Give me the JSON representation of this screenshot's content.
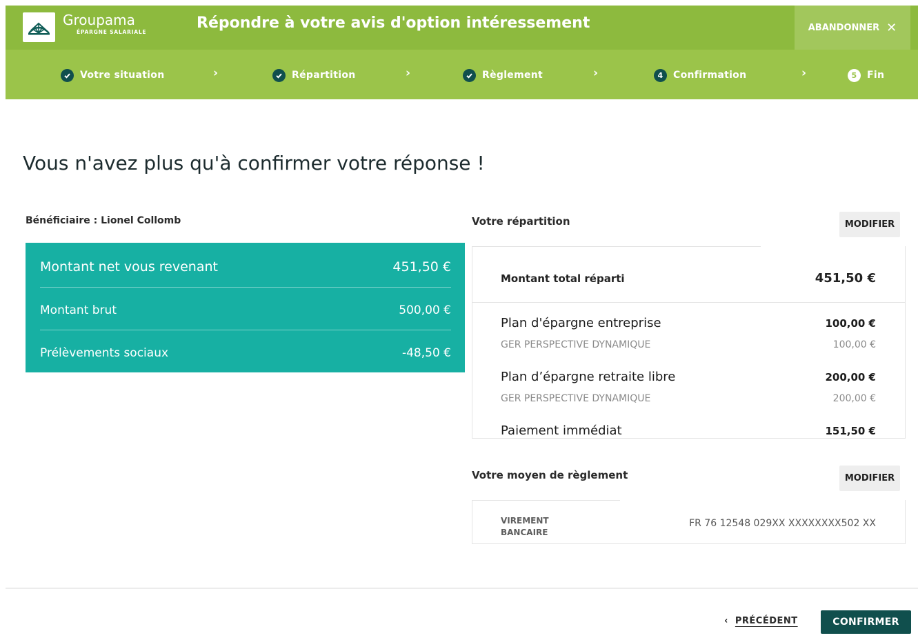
{
  "header": {
    "logo_name": "Groupama",
    "logo_sub": "ÉPARGNE SALARIALE",
    "title": "Répondre à votre avis d'option intéressement",
    "abandon_label": "ABANDONNER",
    "abandon_icon": "close-icon"
  },
  "stepper": {
    "steps": [
      {
        "label": "Votre situation",
        "status": "done",
        "icon": "check-icon"
      },
      {
        "label": "Répartition",
        "status": "done",
        "icon": "check-icon"
      },
      {
        "label": "Règlement",
        "status": "done",
        "icon": "check-icon"
      },
      {
        "label": "Confirmation",
        "status": "current",
        "number": "4"
      },
      {
        "label": "Fin",
        "status": "upcoming",
        "number": "5"
      }
    ],
    "separator": "›"
  },
  "main": {
    "title": "Vous n'avez plus qu'à confirmer votre réponse !",
    "beneficiary": "Bénéficiaire : Lionel Collomb"
  },
  "summary": {
    "net_label": "Montant net vous revenant",
    "net_value": "451,50 €",
    "gross_label": "Montant brut",
    "gross_value": "500,00 €",
    "social_label": "Prélèvements sociaux",
    "social_value": "-48,50 €"
  },
  "repartition": {
    "section_label": "Votre répartition",
    "modify_label": "MODIFIER",
    "total_label": "Montant total réparti",
    "total_value": "451,50 €",
    "plans": [
      {
        "name": "Plan d'épargne entreprise",
        "amount": "100,00 €",
        "fund": "GER PERSPECTIVE DYNAMIQUE",
        "fund_amount": "100,00 €"
      },
      {
        "name": "Plan d’épargne retraite libre",
        "amount": "200,00 €",
        "fund": "GER PERSPECTIVE DYNAMIQUE",
        "fund_amount": "200,00 €"
      }
    ],
    "immediate_label": "Paiement immédiat",
    "immediate_value": "151,50 €"
  },
  "payment": {
    "section_label": "Votre moyen de règlement",
    "modify_label": "MODIFIER",
    "method_line1": "VIREMENT",
    "method_line2": "BANCAIRE",
    "iban": "FR 76 12548 029XX XXXXXXXX502 XX"
  },
  "footer": {
    "prev_label": "PRÉCÉDENT",
    "confirm_label": "CONFIRMER"
  },
  "colors": {
    "header_green": "#8dba3e",
    "stepper_green": "#9bc44a",
    "teal": "#17b0a3",
    "dark_teal": "#104f4d"
  }
}
